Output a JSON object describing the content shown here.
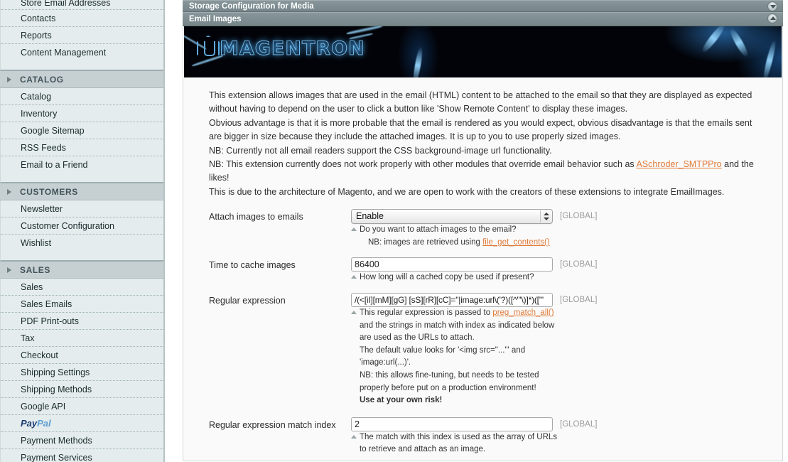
{
  "sidebar": {
    "groups": [
      {
        "section": null,
        "items": [
          {
            "label": "Store Email Addresses",
            "type": "link",
            "clipped": true
          },
          {
            "label": "Contacts",
            "type": "link"
          },
          {
            "label": "Reports",
            "type": "link"
          },
          {
            "label": "Content Management",
            "type": "link"
          }
        ]
      },
      {
        "section": "CATALOG",
        "items": [
          {
            "label": "Catalog",
            "type": "link"
          },
          {
            "label": "Inventory",
            "type": "link"
          },
          {
            "label": "Google Sitemap",
            "type": "link"
          },
          {
            "label": "RSS Feeds",
            "type": "link"
          },
          {
            "label": "Email to a Friend",
            "type": "link"
          }
        ]
      },
      {
        "section": "CUSTOMERS",
        "items": [
          {
            "label": "Newsletter",
            "type": "link"
          },
          {
            "label": "Customer Configuration",
            "type": "link"
          },
          {
            "label": "Wishlist",
            "type": "link"
          }
        ]
      },
      {
        "section": "SALES",
        "items": [
          {
            "label": "Sales",
            "type": "link"
          },
          {
            "label": "Sales Emails",
            "type": "link"
          },
          {
            "label": "PDF Print-outs",
            "type": "link"
          },
          {
            "label": "Tax",
            "type": "link"
          },
          {
            "label": "Checkout",
            "type": "link"
          },
          {
            "label": "Shipping Settings",
            "type": "link"
          },
          {
            "label": "Shipping Methods",
            "type": "link"
          },
          {
            "label": "Google API",
            "type": "link"
          },
          {
            "label": "PayPal",
            "type": "paypal",
            "part_a": "Pay",
            "part_b": "Pal"
          },
          {
            "label": "Payment Methods",
            "type": "link"
          },
          {
            "label": "Payment Services",
            "type": "link",
            "clipped": true
          }
        ]
      }
    ]
  },
  "content": {
    "bars": [
      {
        "title": "Storage Configuration for Media",
        "state": "collapsed",
        "icon": "chevron-down-icon"
      },
      {
        "title": "Email Images",
        "state": "expanded",
        "icon": "chevron-up-icon"
      }
    ],
    "banner": {
      "logo_text": "MAGENTRON",
      "alt": "Magentron banner"
    },
    "description": {
      "line1": "This extension allows images that are used in the email (HTML) content to be attached to the email so that they are displayed as expected without having to depend on the user to click a button like 'Show Remote Content' to display these images.",
      "line2": "Obvious advantage is that it is more probable that the email is rendered as you would expect, obvious disadvantage is that the emails sent are bigger in size because they include the attached images. It is up to you to use properly sized images.",
      "line3": "NB: Currently not all email readers support the CSS background-image url functionality.",
      "line4_pre": "NB: This extension currently does not work properly with other modules that override email behavior such as ",
      "line4_link": "ASchroder_SMTPPro",
      "line4_post": " and the likes!",
      "line5": "This is due to the architecture of Magento, and we are open to work with the creators of these extensions to integrate EmailImages."
    },
    "fields": [
      {
        "label": "Attach images to emails",
        "control": "select",
        "value": "Enable",
        "scope": "[GLOBAL]",
        "note_line1": "Do you want to attach images to the email?",
        "note_line2_pre": "NB: images are retrieved using ",
        "note_line2_link": "file_get_contents()"
      },
      {
        "label": "Time to cache images",
        "control": "text",
        "value": "86400",
        "scope": "[GLOBAL]",
        "note_line1": "How long will a cached copy be used if present?"
      },
      {
        "label": "Regular expression",
        "control": "text",
        "value": "/(<[iI][mM][gG] [sS][rR][cC]=\"|image:url\\('?)([^'\"\\)]*)([\"'",
        "scope": "[GLOBAL]",
        "note_line1_pre": "This regular expression is passed to ",
        "note_line1_link": "preg_match_all()",
        "note_line1_post": " and the strings in match with index as indicated below are used as the URLs to attach.",
        "note_line2": "The default value looks for '<img src=\"...\"' and 'image:url(...)'.",
        "note_line3": "NB: this allows fine-tuning, but needs to be tested properly before put on a production environment!",
        "note_line4": "Use at your own risk!"
      },
      {
        "label": "Regular expression match index",
        "control": "text",
        "value": "2",
        "scope": "[GLOBAL]",
        "note_line1": "The match with this index is used as the array of URLs to retrieve and attach as an image."
      }
    ]
  }
}
